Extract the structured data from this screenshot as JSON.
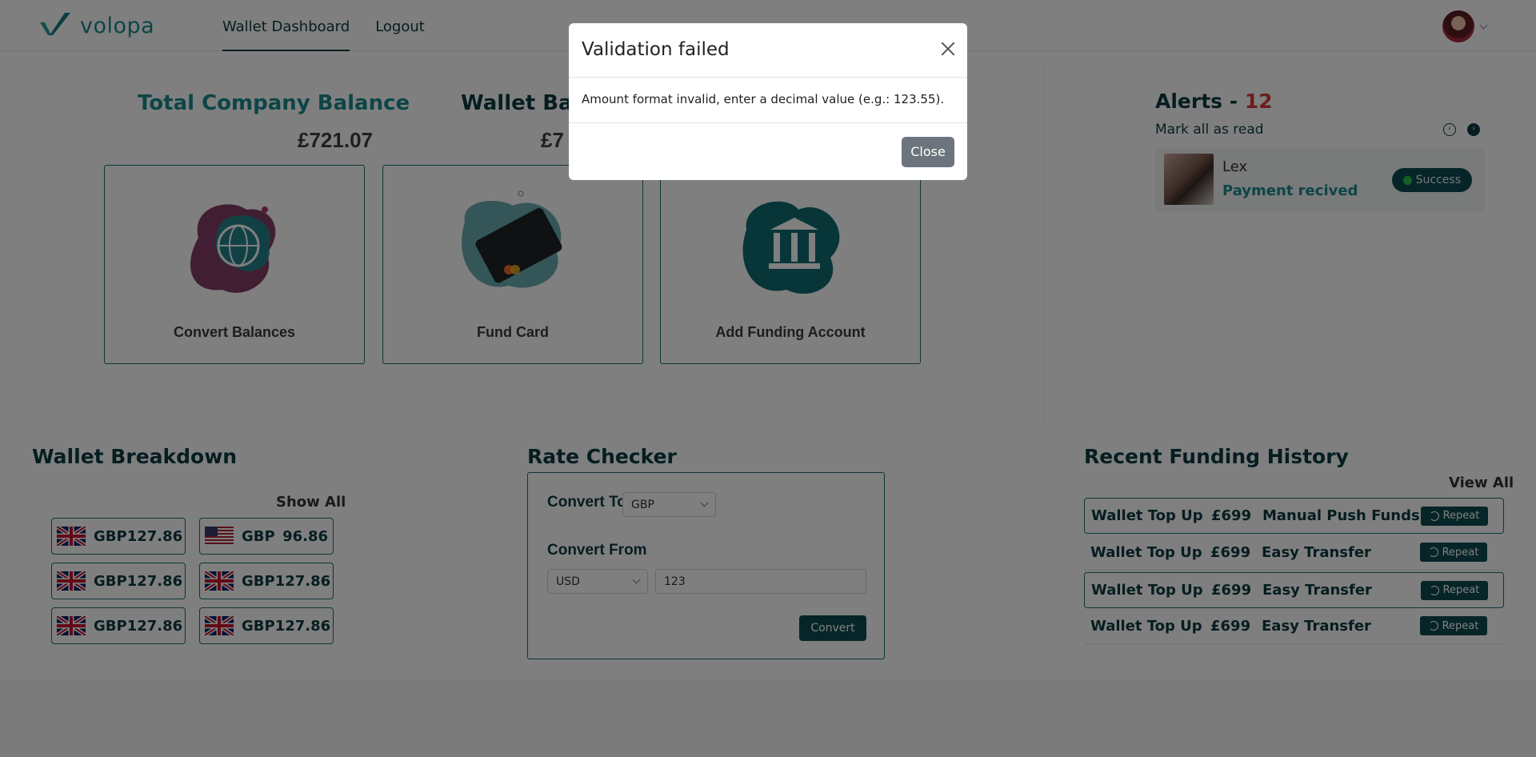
{
  "header": {
    "logo_text": "volopa",
    "nav": [
      {
        "label": "Wallet Dashboard",
        "active": true
      },
      {
        "label": "Logout",
        "active": false
      }
    ]
  },
  "balances": {
    "total_title": "Total Company Balance",
    "total_amount": "£721.07",
    "wallet_title": "Wallet Bal",
    "wallet_amount": "£7"
  },
  "action_cards": [
    {
      "label": "Convert Balances",
      "icon": "globe-icon"
    },
    {
      "label": "Fund Card",
      "icon": "card-icon"
    },
    {
      "label": "Add Funding Account",
      "icon": "bank-icon"
    }
  ],
  "alerts": {
    "title": "Alerts - ",
    "count": "12",
    "mark_all": "Mark all as read",
    "items": [
      {
        "name": "Lex",
        "message": "Payment recived",
        "status": "Success"
      }
    ]
  },
  "wallet_breakdown": {
    "title": "Wallet Breakdown",
    "show_all": "Show All",
    "wallets": [
      {
        "flag": "uk",
        "code": "GBP",
        "amount": "127.86"
      },
      {
        "flag": "us",
        "code": "GBP",
        "amount": "96.86"
      },
      {
        "flag": "uk",
        "code": "GBP",
        "amount": "127.86"
      },
      {
        "flag": "uk",
        "code": "GBP",
        "amount": "127.86"
      },
      {
        "flag": "uk",
        "code": "GBP",
        "amount": "127.86"
      },
      {
        "flag": "uk",
        "code": "GBP",
        "amount": "127.86"
      }
    ]
  },
  "rate_checker": {
    "title": "Rate Checker",
    "convert_to_label": "Convert To",
    "convert_to_value": "GBP",
    "convert_from_label": "Convert From",
    "convert_from_value": "USD",
    "amount_value": "123",
    "convert_button": "Convert"
  },
  "funding_history": {
    "title": "Recent Funding History",
    "view_all": "View All",
    "rows": [
      {
        "type": "Wallet Top Up",
        "amount": "£699",
        "method": "Manual Push Funds",
        "action": "Repeat"
      },
      {
        "type": "Wallet Top Up",
        "amount": "£699",
        "method": "Easy Transfer",
        "action": "Repeat"
      },
      {
        "type": "Wallet Top Up",
        "amount": "£699",
        "method": "Easy Transfer",
        "action": "Repeat"
      },
      {
        "type": "Wallet Top Up",
        "amount": "£699",
        "method": "Easy Transfer",
        "action": "Repeat"
      }
    ]
  },
  "modal": {
    "title": "Validation failed",
    "message": "Amount format invalid, enter a decimal value (e.g.: 123.55).",
    "close_button": "Close"
  },
  "colors": {
    "brand_teal": "#1a8a8e",
    "brand_dark": "#0d3b40",
    "alert_count": "#d93b3b",
    "success_dot": "#2ac14b",
    "close_button": "#6c757d"
  }
}
